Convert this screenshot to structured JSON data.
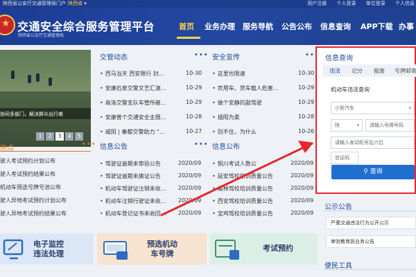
{
  "topbar": {
    "left": "陕西省公安厅交通管理局门户",
    "province": "陕西省",
    "links": [
      "用户注册",
      "个人登录",
      "单位登录",
      "个人信息"
    ]
  },
  "header": {
    "title": "交通安全综合服务管理平台",
    "subtitle": "陕西省公安厅交通管理局"
  },
  "nav": {
    "items": [
      "首页",
      "业务办理",
      "服务导航",
      "公告公布",
      "信息查询",
      "APP下载",
      "办事"
    ],
    "active": "首页"
  },
  "slider": {
    "caption": "协同多部门，解决群众出行难",
    "pages": [
      "1",
      "2",
      "3",
      "4",
      "5"
    ],
    "active_page": "3"
  },
  "news": {
    "title": "交管动态",
    "more": "•••",
    "items": [
      {
        "text": "西马当天 西安限行 封…",
        "date": "10-30"
      },
      {
        "text": "安康石泉交警文艺汇演…",
        "date": "10-29"
      },
      {
        "text": "商洛交警支队车管所被…",
        "date": "10-29"
      },
      {
        "text": "安康普个交通安全主题…",
        "date": "10-28"
      },
      {
        "text": "咸阳 | 秦都交警助力 \"…",
        "date": "10-27"
      }
    ]
  },
  "safety": {
    "title": "安全宣传",
    "more": "•••",
    "items": [
      {
        "text": "这里也限速",
        "date": "10-30"
      },
      {
        "text": "农用车、货车载人危害…",
        "date": "10-29"
      },
      {
        "text": "做个安静的副驾驶",
        "date": "10-29"
      },
      {
        "text": "插阳为柔",
        "date": "10-28"
      },
      {
        "text": "别不住，为什么",
        "date": "10-26"
      }
    ]
  },
  "hot": {
    "title": "热点",
    "more": "•••",
    "items": [
      "驶人考试预约计划公布",
      "驶人考试预约结果公布",
      "机动车预选号牌号池公布",
      "驶人异地考试预约计划公布",
      "驶人异地考试预约结果公布"
    ]
  },
  "notices": {
    "title": "信息公告",
    "more": "•••",
    "items": [
      {
        "text": "驾驶证逾期未审验公告",
        "date": "2020/09"
      },
      {
        "text": "驾驶证逾期未换证公告",
        "date": "2020/09"
      },
      {
        "text": "机动车驾驶证注销未收…",
        "date": "2020/09"
      },
      {
        "text": "机动车注销行驶证未收…",
        "date": "2020/09"
      },
      {
        "text": "机动车登记证书未收回…",
        "date": "2020/09"
      }
    ]
  },
  "info_release": {
    "title": "信息公布",
    "more": "•••",
    "items": [
      {
        "text": "铜川考试人数公",
        "date": "2020/09"
      },
      {
        "text": "延安驾校培训质量公告",
        "date": "2020/09"
      },
      {
        "text": "榆林驾校培训质量公告",
        "date": "2020/09"
      },
      {
        "text": "西安驾校培训质量公告",
        "date": "2020/09"
      },
      {
        "text": "宝鸡驾校培训质量公告",
        "date": "2020/09"
      }
    ]
  },
  "tiles": [
    {
      "line1": "电子监控",
      "line2": "违法处理",
      "color": "#dbe7f6"
    },
    {
      "line1": "预选机动",
      "line2": "车号牌",
      "color": "#f6e3d0"
    },
    {
      "line1": "考试预约",
      "line2": "",
      "color": "#dcefe6"
    }
  ],
  "query": {
    "title": "信息查询",
    "tabs": [
      "违法",
      "记分",
      "报废",
      "号牌邮寄"
    ],
    "active_tab": "违法",
    "subtitle": "机动车违法查询",
    "vehicle_type": "小型汽车",
    "plate_prefix": "陕",
    "plate_placeholder": "请输入号牌号码",
    "engine_placeholder": "请输入发动机号后六位",
    "captcha_placeholder": "验证码",
    "submit": "查询",
    "search_icon": "search-icon"
  },
  "side": {
    "notice_title": "公示公告",
    "notice_items": [
      "严重交通违法行为公开公示",
      "审验教育拆业务公告"
    ],
    "tools_title": "便民工具"
  },
  "colors": {
    "header_bg": "#1b3d95",
    "accent": "#ffd34d",
    "highlight_border": "#e5262d",
    "button": "#1f6fd1"
  }
}
